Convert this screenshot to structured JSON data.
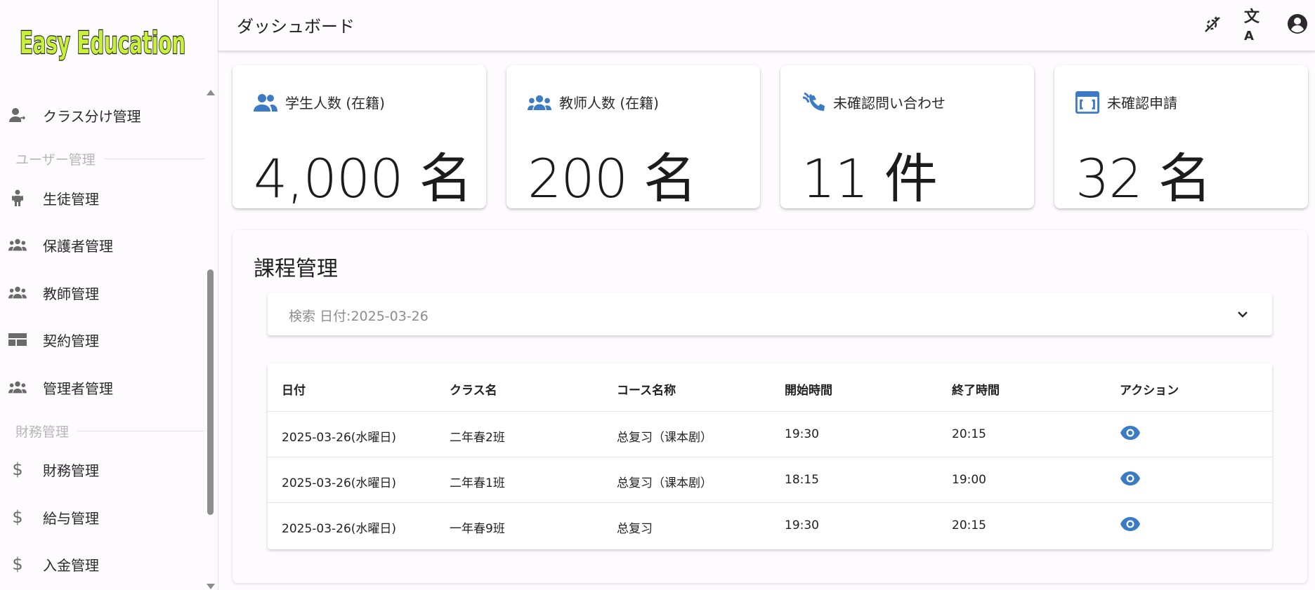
{
  "app": {
    "logo_text": "Easy Education"
  },
  "header": {
    "title": "ダッシュボード"
  },
  "topbar_icons": [
    "theme-toggle-icon",
    "translate-icon",
    "account-circle-icon"
  ],
  "sidebar": {
    "items": [
      {
        "label": "クラス分け管理",
        "icon": "person-assign-icon"
      },
      {
        "section": "ユーザー管理"
      },
      {
        "label": "生徒管理",
        "icon": "child-icon"
      },
      {
        "label": "保護者管理",
        "icon": "groups-icon"
      },
      {
        "label": "教師管理",
        "icon": "groups-icon"
      },
      {
        "label": "契約管理",
        "icon": "table-icon"
      },
      {
        "label": "管理者管理",
        "icon": "groups-icon"
      },
      {
        "section": "財務管理"
      },
      {
        "label": "財務管理",
        "icon": "dollar-icon"
      },
      {
        "label": "給与管理",
        "icon": "dollar-icon"
      },
      {
        "label": "入金管理",
        "icon": "dollar-icon"
      }
    ]
  },
  "stats": [
    {
      "label": "学生人数 (在籍)",
      "value": "4,000 名",
      "icon": "people-icon"
    },
    {
      "label": "教师人数 (在籍)",
      "value": "200 名",
      "icon": "groups-icon"
    },
    {
      "label": "未確認問い合わせ",
      "value": "11 件",
      "icon": "call-received-icon"
    },
    {
      "label": "未確認申請",
      "value": "32 名",
      "icon": "calendar-view-icon"
    }
  ],
  "course_panel": {
    "title": "課程管理",
    "search_label": "検索 日付:2025-03-26",
    "columns": [
      "日付",
      "クラス名",
      "コース名称",
      "開始時間",
      "終了時間",
      "アクション"
    ],
    "rows": [
      {
        "date": "2025-03-26(水曜日)",
        "class": "二年春2班",
        "course": "总复习（课本剧）",
        "start": "19:30",
        "end": "20:15"
      },
      {
        "date": "2025-03-26(水曜日)",
        "class": "二年春1班",
        "course": "总复习（课本剧）",
        "start": "18:15",
        "end": "19:00"
      },
      {
        "date": "2025-03-26(水曜日)",
        "class": "一年春9班",
        "course": "总复习",
        "start": "19:30",
        "end": "20:15"
      }
    ]
  },
  "colors": {
    "accent": "#3b7ac4",
    "logo_fill": "#c7f03a",
    "icon_gray": "#666666"
  }
}
